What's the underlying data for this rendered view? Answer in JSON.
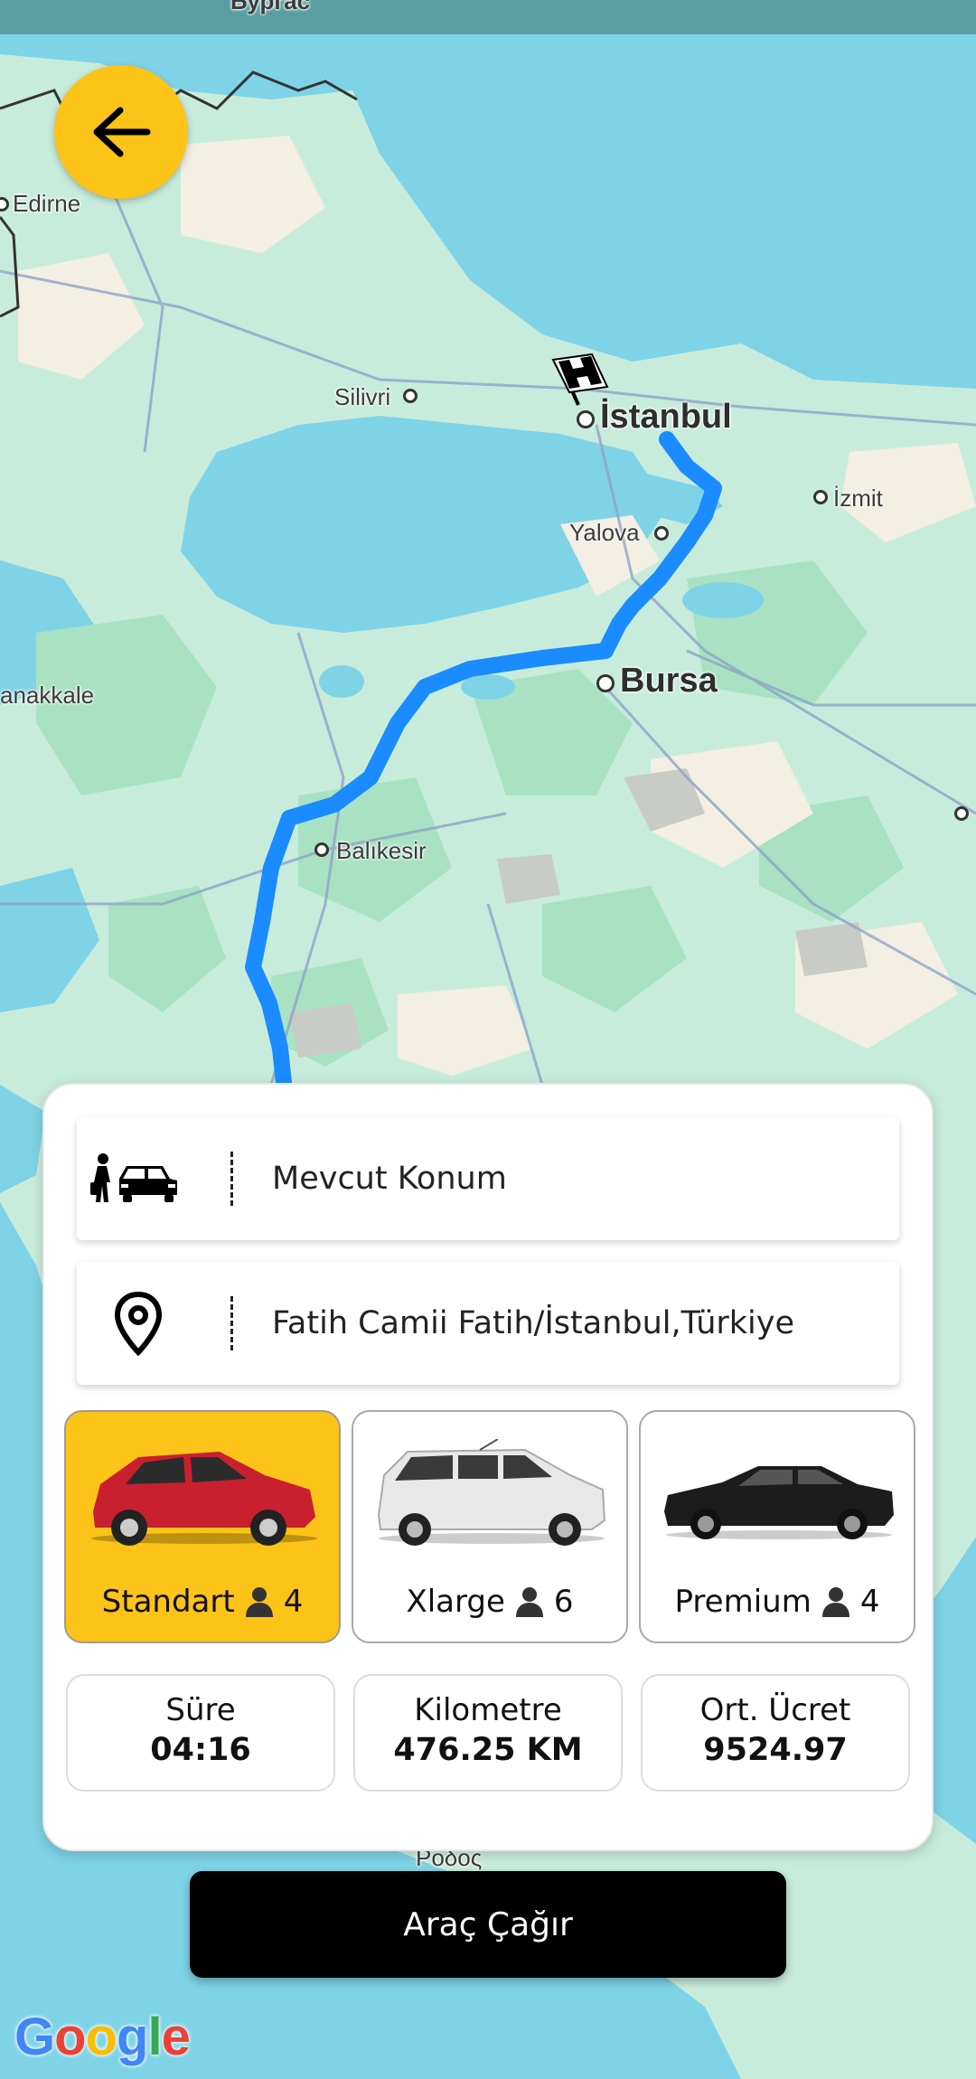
{
  "map": {
    "top_label": "Бургас",
    "cities": {
      "edirne": "Edirne",
      "silivri": "Silivri",
      "istanbul": "İstanbul",
      "izmit": "İzmit",
      "yalova": "Yalova",
      "bursa": "Bursa",
      "canakkale": "anakkale",
      "balikesir": "Balıkesir",
      "rhodes": "Ρόδος"
    },
    "route_color": "#1a8cff",
    "attribution": "Google"
  },
  "back_button": {
    "icon": "arrow-left-icon"
  },
  "pickup": {
    "icon": "passenger-car-icon",
    "text": "Mevcut Konum"
  },
  "destination": {
    "icon": "location-pin-icon",
    "text": "Fatih Camii Fatih/İstanbul,Türkiye"
  },
  "vehicles": [
    {
      "name": "Standart",
      "capacity": "4",
      "color": "#c8202e",
      "selected": true
    },
    {
      "name": "Xlarge",
      "capacity": "6",
      "color": "#e8e8e8",
      "selected": false
    },
    {
      "name": "Premium",
      "capacity": "4",
      "color": "#1c1c1c",
      "selected": false
    }
  ],
  "stats": [
    {
      "label": "Süre",
      "value": "04:16"
    },
    {
      "label": "Kilometre",
      "value": "476.25 KM"
    },
    {
      "label": "Ort. Ücret",
      "value": "9524.97"
    }
  ],
  "call_button": "Araç Çağır",
  "accent_color": "#fcc318"
}
